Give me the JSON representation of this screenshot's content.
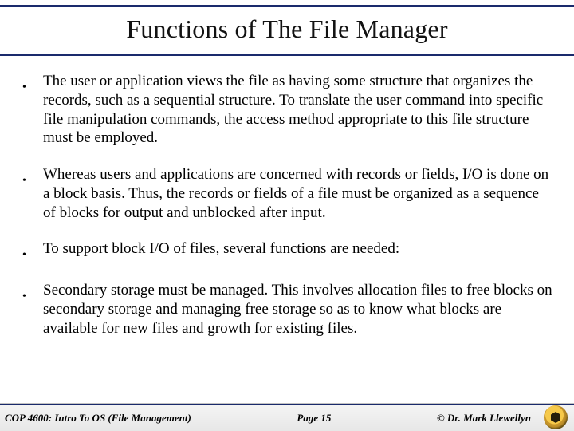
{
  "title": "Functions of The File Manager",
  "bullets": [
    "The user or application views the file as having some structure that organizes the records, such as a sequential structure.  To translate the user command into specific file manipulation commands, the access method appropriate to this file structure must be employed.",
    "Whereas users and applications are concerned with records or fields, I/O is done on a block basis.  Thus, the records or fields of a file must be organized as a sequence of blocks for output and unblocked after input.",
    "To support block I/O of files, several functions are needed:",
    "Secondary storage must be managed.  This involves allocation files to free blocks on secondary storage and managing free storage so as to know what blocks are available for new files and growth for existing files."
  ],
  "footer": {
    "left": "COP 4600: Intro To OS  (File Management)",
    "center": "Page 15",
    "right": "© Dr. Mark Llewellyn"
  },
  "colors": {
    "rule": "#1a2a6c"
  }
}
